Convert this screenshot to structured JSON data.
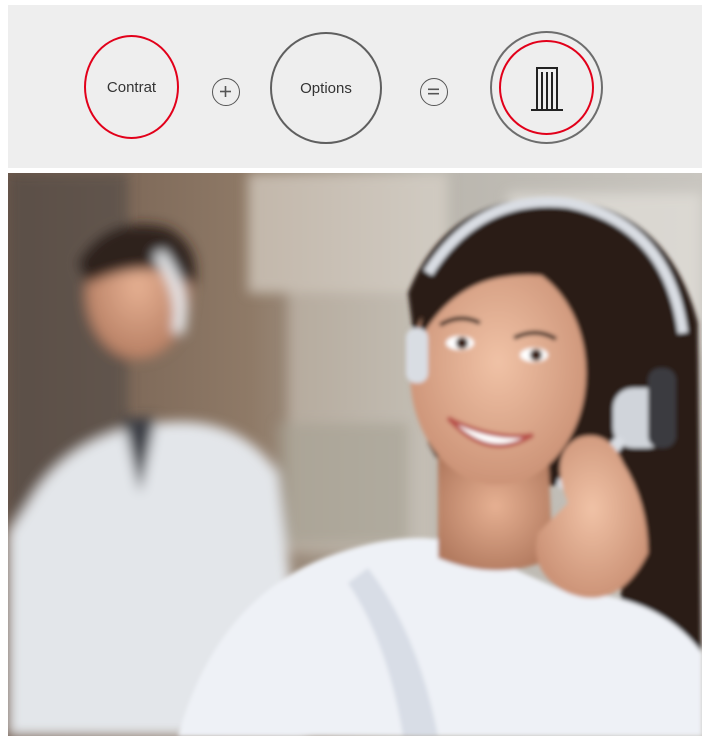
{
  "formula": {
    "left_label": "Contrat",
    "middle_label": "Options",
    "plus_icon": "plus-icon",
    "equals_icon": "equals-icon",
    "result_icon": "building-icon"
  },
  "colors": {
    "accent": "#e2001a",
    "banner_bg": "#eeeeee",
    "outline": "#5f5f5f"
  },
  "photo": {
    "subject": "call-center-agent-photo"
  }
}
